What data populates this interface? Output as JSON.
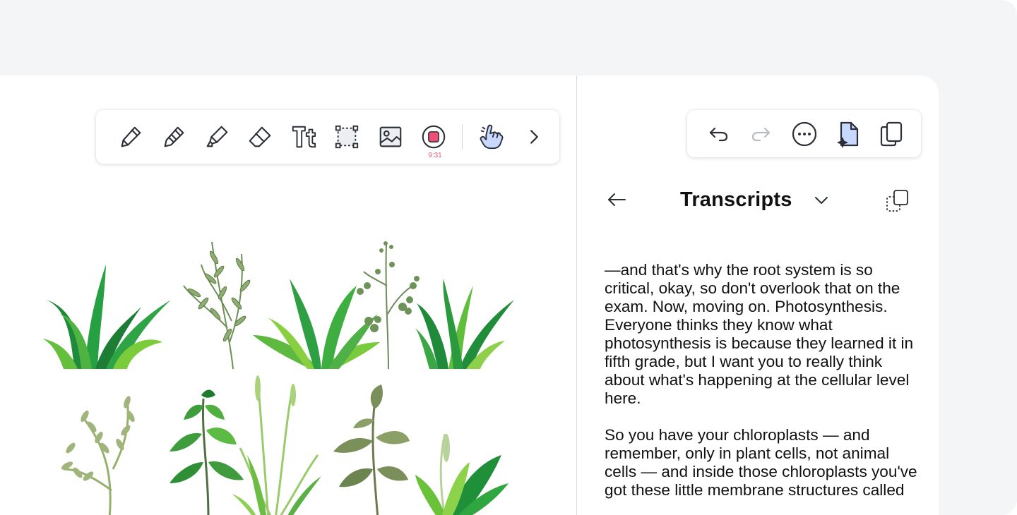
{
  "canvas_toolbar": {
    "tools": [
      {
        "name": "pen-tool",
        "icon": "pen-icon"
      },
      {
        "name": "pencil-tool",
        "icon": "pencil-icon"
      },
      {
        "name": "highlighter-tool",
        "icon": "highlighter-icon"
      },
      {
        "name": "eraser-tool",
        "icon": "eraser-icon"
      },
      {
        "name": "text-tool",
        "icon": "text-icon"
      },
      {
        "name": "selection-tool",
        "icon": "lasso-select-icon"
      },
      {
        "name": "image-tool",
        "icon": "image-icon"
      },
      {
        "name": "record-tool",
        "icon": "record-icon"
      },
      {
        "name": "hand-tool",
        "icon": "pointer-hand-icon"
      },
      {
        "name": "more-tools",
        "icon": "chevron-right-icon"
      }
    ],
    "text_tool_glyph": "Tt",
    "record_timer": "9:31",
    "accent_record": "#ef4f72",
    "accent_hand": "#c9d8ff"
  },
  "edit_toolbar": {
    "buttons": [
      {
        "name": "undo-button",
        "icon": "undo-icon",
        "enabled": true
      },
      {
        "name": "redo-button",
        "icon": "redo-icon",
        "enabled": false
      },
      {
        "name": "more-options-button",
        "icon": "ellipsis-icon"
      },
      {
        "name": "ai-document-button",
        "icon": "sparkle-document-icon"
      },
      {
        "name": "copy-pages-button",
        "icon": "copy-icon"
      }
    ]
  },
  "panel": {
    "title": "Transcripts",
    "transcript_paragraphs": [
      "—and that's why the root system is so critical, okay, so don't overlook that on the exam. Now, moving on. Photosynthesis. Everyone thinks they know what photosynthesis is because they learned it in fifth grade, but I want you to really think about what's happening at the cellular level here.",
      "So you have your chloroplasts — and remember, only in plant cells, not animal cells — and inside those chloroplasts you've got these little membrane structures called"
    ]
  },
  "canvas": {
    "image": "plant-illustrations"
  }
}
